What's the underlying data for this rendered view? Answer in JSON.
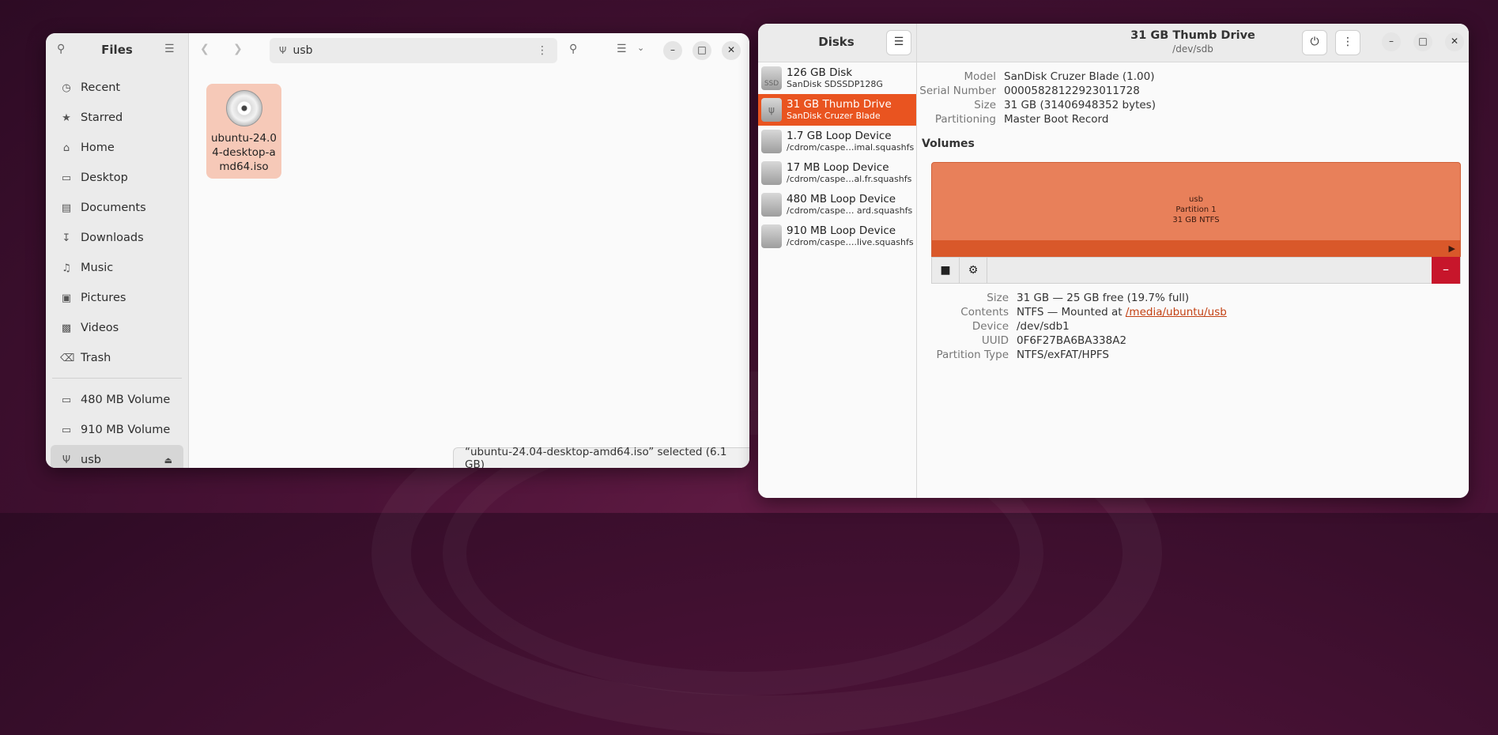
{
  "files": {
    "title": "Files",
    "path": "usb",
    "sidebar": [
      {
        "icon": "clock-icon",
        "label": "Recent"
      },
      {
        "icon": "star-icon",
        "label": "Starred"
      },
      {
        "icon": "home-icon",
        "label": "Home"
      },
      {
        "icon": "desktop-icon",
        "label": "Desktop"
      },
      {
        "icon": "documents-icon",
        "label": "Documents"
      },
      {
        "icon": "downloads-icon",
        "label": "Downloads"
      },
      {
        "icon": "music-icon",
        "label": "Music"
      },
      {
        "icon": "pictures-icon",
        "label": "Pictures"
      },
      {
        "icon": "videos-icon",
        "label": "Videos"
      },
      {
        "icon": "trash-icon",
        "label": "Trash"
      }
    ],
    "volumes": [
      {
        "icon": "drive-icon",
        "label": "480 MB Volume"
      },
      {
        "icon": "drive-icon",
        "label": "910 MB Volume"
      },
      {
        "icon": "usb-icon",
        "label": "usb"
      }
    ],
    "file": {
      "name": "ubuntu-24.04-desktop-amd64.iso"
    },
    "status": "“ubuntu-24.04-desktop-amd64.iso” selected  (6.1 GB)"
  },
  "disks": {
    "title": "Disks",
    "devices": [
      {
        "name": "126 GB Disk",
        "sub": "SanDisk SDSSDP128G",
        "icon_text": "SSD"
      },
      {
        "name": "31 GB Thumb Drive",
        "sub": "SanDisk Cruzer Blade",
        "icon_text": "ψ"
      },
      {
        "name": "1.7 GB Loop Device",
        "sub": "/cdrom/caspe…imal.squashfs",
        "icon_text": ""
      },
      {
        "name": "17 MB Loop Device",
        "sub": "/cdrom/caspe…al.fr.squashfs",
        "icon_text": ""
      },
      {
        "name": "480 MB Loop Device",
        "sub": "/cdrom/caspe… ard.squashfs",
        "icon_text": ""
      },
      {
        "name": "910 MB Loop Device",
        "sub": "/cdrom/caspe….live.squashfs",
        "icon_text": ""
      }
    ],
    "selected": {
      "title": "31 GB Thumb Drive",
      "subtitle": "/dev/sdb",
      "model_label": "Model",
      "model": "SanDisk Cruzer Blade (1.00)",
      "serial_label": "Serial Number",
      "serial": "00005828122923011728",
      "size_label": "Size",
      "size": "31 GB (31406948352 bytes)",
      "partitioning_label": "Partitioning",
      "partitioning": "Master Boot Record"
    },
    "volumes_heading": "Volumes",
    "volume": {
      "name": "usb",
      "partition": "Partition 1",
      "fs": "31 GB NTFS",
      "size_label": "Size",
      "size": "31 GB — 25 GB free (19.7% full)",
      "contents_label": "Contents",
      "contents": "NTFS — Mounted at",
      "mount": "/media/ubuntu/usb",
      "device_label": "Device",
      "device": "/dev/sdb1",
      "uuid_label": "UUID",
      "uuid": "0F6F27BA6BA338A2",
      "ptype_label": "Partition Type",
      "ptype": "NTFS/exFAT/HPFS"
    }
  }
}
